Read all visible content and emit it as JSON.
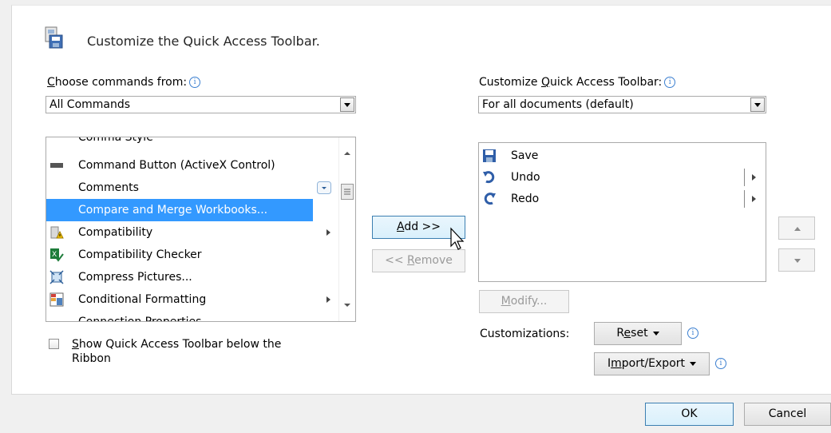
{
  "header": {
    "icon": "customize-toolbar-icon",
    "title": "Customize the Quick Access Toolbar."
  },
  "left": {
    "choose_label_prefix": "C",
    "choose_label_rest": "hoose commands from:",
    "choose_value": "All Commands",
    "commands": [
      {
        "label": "Comma Style",
        "icon": "comma-style-icon",
        "partial": "top"
      },
      {
        "label": "Command Button (ActiveX Control)",
        "icon": "command-button-icon"
      },
      {
        "label": "Comments",
        "icon": "",
        "has_dropdown": true
      },
      {
        "label": "Compare and Merge Workbooks...",
        "icon": "",
        "selected": true
      },
      {
        "label": "Compatibility",
        "icon": "compatibility-icon",
        "has_submenu": true
      },
      {
        "label": "Compatibility Checker",
        "icon": "compatibility-checker-icon"
      },
      {
        "label": "Compress Pictures...",
        "icon": "compress-pictures-icon"
      },
      {
        "label": "Conditional Formatting",
        "icon": "conditional-formatting-icon",
        "has_submenu": true
      },
      {
        "label": "Connection Properties",
        "icon": "",
        "partial": "bottom"
      }
    ],
    "show_below_label_prefix": "S",
    "show_below_label_rest": "how Quick Access Toolbar below the",
    "show_below_label_line2": "Ribbon",
    "show_below_checked": false
  },
  "middle": {
    "add_prefix": "A",
    "add_rest": "dd >>",
    "remove_prefix": "<< ",
    "remove_u": "R",
    "remove_rest": "emove"
  },
  "right": {
    "customize_label_prefix": "Customize ",
    "customize_label_u": "Q",
    "customize_label_rest": "uick Access Toolbar:",
    "customize_value": "For all documents (default)",
    "toolbar_items": [
      {
        "label": "Save",
        "icon": "save-icon"
      },
      {
        "label": "Undo",
        "icon": "undo-icon",
        "has_submenu": true
      },
      {
        "label": "Redo",
        "icon": "redo-icon",
        "has_submenu": true
      }
    ],
    "modify_u": "M",
    "modify_rest": "odify...",
    "customizations_label": "Customizations:",
    "reset_prefix": "R",
    "reset_u": "e",
    "reset_rest": "set",
    "import_prefix": "I",
    "import_u": "m",
    "import_rest": "port/Export"
  },
  "footer": {
    "ok_label": "OK",
    "cancel_label": "Cancel"
  }
}
